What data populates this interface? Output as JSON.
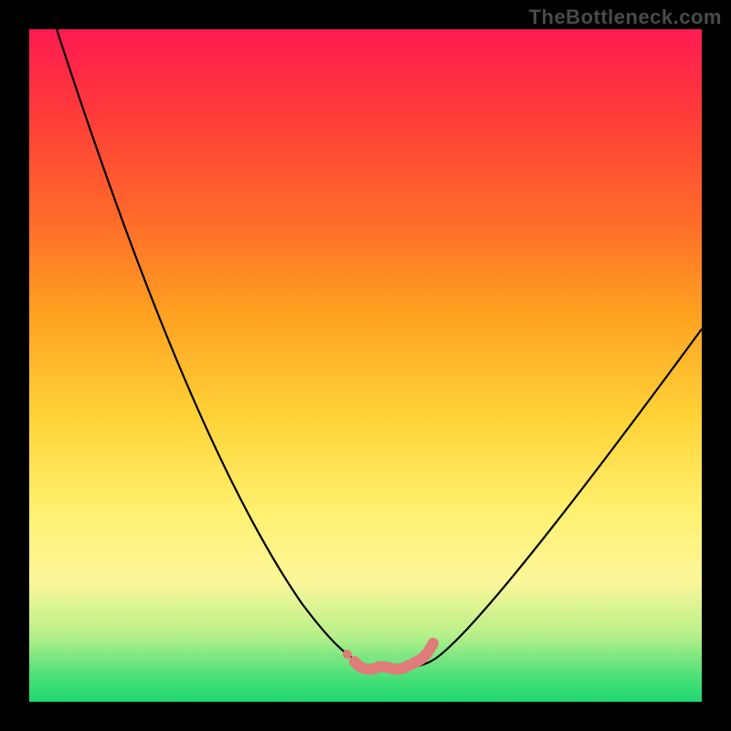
{
  "watermark": "TheBottleneck.com",
  "chart_data": {
    "type": "line",
    "title": "",
    "xlabel": "",
    "ylabel": "",
    "xlim": [
      0,
      100
    ],
    "ylim": [
      0,
      100
    ],
    "series": [
      {
        "name": "bottleneck-curve",
        "x": [
          5,
          10,
          15,
          20,
          25,
          30,
          35,
          40,
          45,
          48,
          50,
          52,
          55,
          58,
          60,
          65,
          70,
          75,
          80,
          85,
          90,
          95,
          100
        ],
        "y": [
          100,
          88,
          76,
          64,
          52,
          41,
          31,
          22,
          12,
          7,
          4,
          2,
          1,
          1,
          2,
          6,
          12,
          20,
          28,
          36,
          44,
          52,
          60
        ]
      }
    ],
    "bottleneck_marker": {
      "x_range": [
        50,
        60
      ],
      "y": 1
    },
    "colors": {
      "curve": "#000000",
      "marker": "#e07a7a",
      "background_top": "#ff1a52",
      "background_bottom": "#1fd870"
    }
  }
}
